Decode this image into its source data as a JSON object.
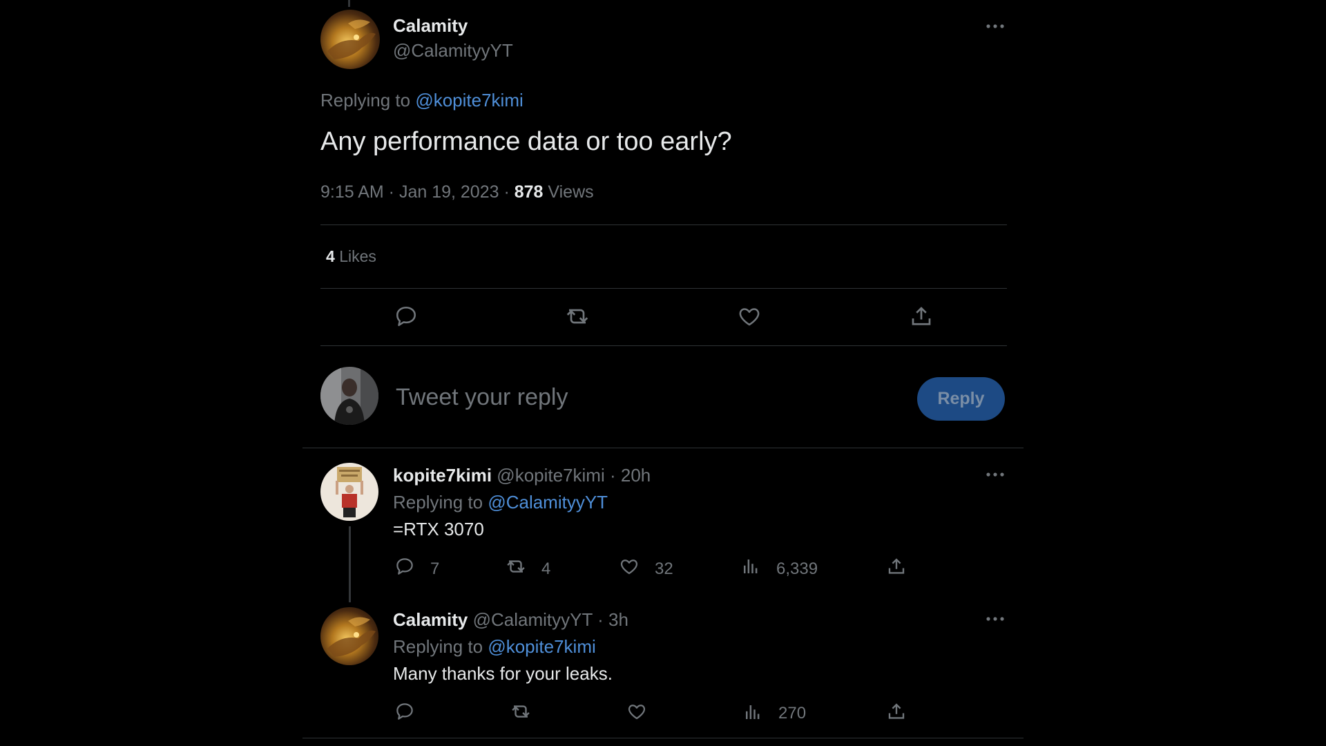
{
  "main_tweet": {
    "author_name": "Calamity",
    "handle": "@CalamityyYT",
    "replying_prefix": "Replying to",
    "replying_to": "@kopite7kimi",
    "text": "Any performance data or too early?",
    "timestamp": "9:15 AM · Jan 19, 2023 · ",
    "views_count": "878",
    "views_label": "Views",
    "likes_count": "4",
    "likes_label": "Likes"
  },
  "composer": {
    "placeholder": "Tweet your reply",
    "reply_button": "Reply"
  },
  "replies": [
    {
      "author_name": "kopite7kimi",
      "handle": "@kopite7kimi",
      "time": "· 20h",
      "replying_prefix": "Replying to",
      "replying_to": "@CalamityyYT",
      "text": "=RTX 3070",
      "reply_count": "7",
      "retweet_count": "4",
      "like_count": "32",
      "view_count": "6,339"
    },
    {
      "author_name": "Calamity",
      "handle": "@CalamityyYT",
      "time": "· 3h",
      "replying_prefix": "Replying to",
      "replying_to": "@kopite7kimi",
      "text": "Many thanks for your leaks.",
      "view_count": "270"
    }
  ],
  "icons": {
    "more": "more-icon",
    "reply": "reply-icon",
    "retweet": "retweet-icon",
    "like": "heart-icon",
    "share": "share-icon",
    "views": "views-icon"
  },
  "colors": {
    "background": "#000000",
    "text": "#e7e9ea",
    "muted": "#71767b",
    "link": "#4f8fd9",
    "reply_button_bg": "#1d4a84",
    "divider": "#2f3336"
  }
}
